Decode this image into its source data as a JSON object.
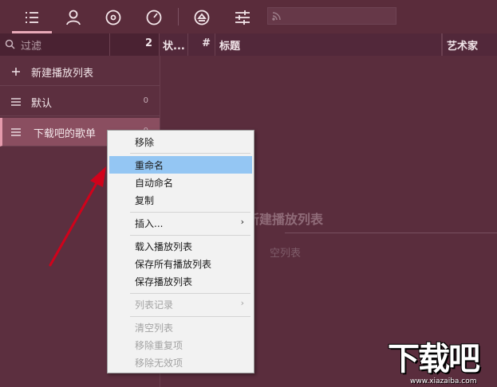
{
  "toolbar": {
    "buttons": [
      {
        "icon": "playlist-icon",
        "active": true
      },
      {
        "icon": "artist-icon",
        "active": false
      },
      {
        "icon": "album-disc-icon",
        "active": false
      },
      {
        "icon": "gauge-icon",
        "active": false
      },
      {
        "icon": "eject-icon",
        "active": false
      },
      {
        "icon": "equalizer-sliders-icon",
        "active": false
      }
    ],
    "search_icon": "rss-feed-icon"
  },
  "filter": {
    "placeholder": "过滤",
    "count": "2"
  },
  "columns": {
    "status": "状...",
    "number": "#",
    "title": "标题",
    "artist": "艺术家"
  },
  "sidebar": {
    "new_playlist": {
      "icon": "plus-icon",
      "label": "新建播放列表"
    },
    "items": [
      {
        "icon": "list-icon",
        "label": "默认",
        "count": "0"
      },
      {
        "icon": "list-icon",
        "label": "下载吧的歌单",
        "count": "0"
      }
    ]
  },
  "main": {
    "empty_title": "新建播放列表",
    "empty_sub": "空列表"
  },
  "context_menu": {
    "items": [
      {
        "label": "移除",
        "disabled": false
      },
      {
        "label": "重命名",
        "disabled": false,
        "highlighted": true
      },
      {
        "label": "自动命名",
        "disabled": false
      },
      {
        "label": "复制",
        "disabled": false
      },
      {
        "label": "插入...",
        "disabled": false,
        "submenu": true
      },
      {
        "label": "载入播放列表",
        "disabled": false
      },
      {
        "label": "保存所有播放列表",
        "disabled": false
      },
      {
        "label": "保存播放列表",
        "disabled": false
      },
      {
        "label": "列表记录",
        "disabled": true,
        "submenu": true
      },
      {
        "label": "清空列表",
        "disabled": true
      },
      {
        "label": "移除重复项",
        "disabled": true
      },
      {
        "label": "移除无效项",
        "disabled": true
      }
    ],
    "submenu_arrow": "›"
  },
  "watermark": {
    "logo": "下载吧",
    "url": "www.xiazaiba.com"
  },
  "colors": {
    "accent": "#e8a9b8",
    "background": "#5c2f3f",
    "menu_highlight": "#94c6f3",
    "arrow": "#d0021b"
  }
}
